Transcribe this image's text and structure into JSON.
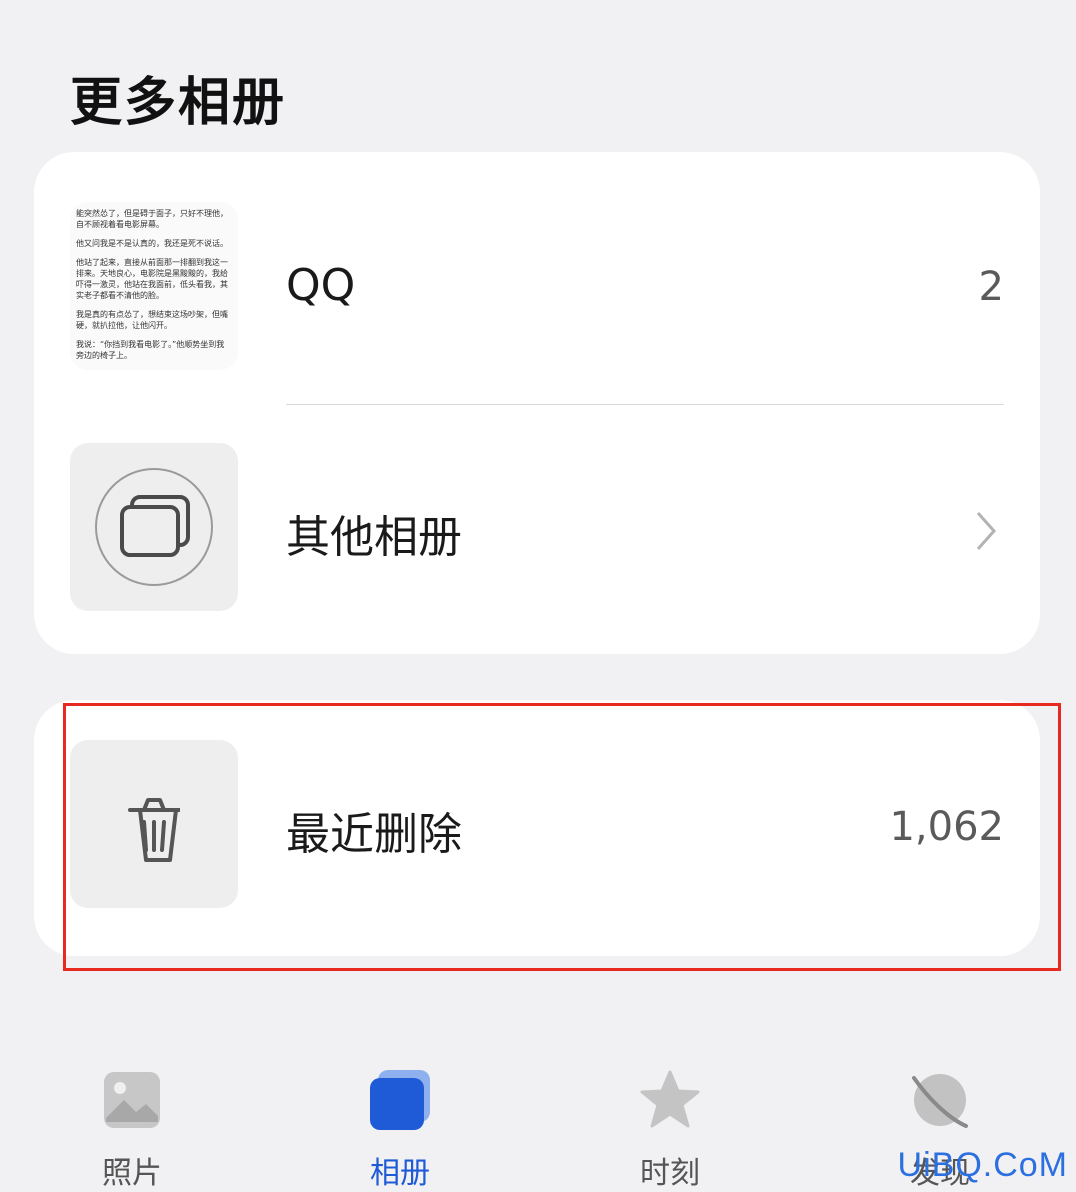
{
  "section": {
    "title": "更多相册"
  },
  "albums": [
    {
      "label": "QQ",
      "count": "2",
      "thumbnail_text": [
        "能突然怂了，但是碍于面子，只好不理他，自不顾视着看电影屏幕。",
        "他又问我是不是认真的，我还是死不说话。",
        "他站了起来，直接从前面那一排翻到我这一排来。天地良心，电影院是黑黢黢的，我给吓得一激灵，他站在我面前，低头看我，其实老子都看不清他的脸。",
        "我是真的有点怂了，想结束这场吵架，但嘴硬，就扒拉他，让他闪开。",
        "我说：“你挡到我看电影了。”他顺势坐到我旁边的椅子上。"
      ]
    },
    {
      "label": "其他相册",
      "icon": "stacked-albums-icon",
      "chevron": "chevron-right-icon"
    }
  ],
  "recently_deleted": {
    "label": "最近删除",
    "count": "1,062",
    "icon": "trash-icon"
  },
  "tabs": [
    {
      "label": "照片",
      "icon": "photo-icon",
      "active": false
    },
    {
      "label": "相册",
      "icon": "album-icon",
      "active": true
    },
    {
      "label": "时刻",
      "icon": "star-icon",
      "active": false
    },
    {
      "label": "发现",
      "icon": "planet-icon",
      "active": false
    }
  ],
  "watermark": "UiBQ.CoM",
  "colors": {
    "accent": "#1f5bd6",
    "highlight": "#e8291f",
    "background": "#f1f1f3"
  }
}
